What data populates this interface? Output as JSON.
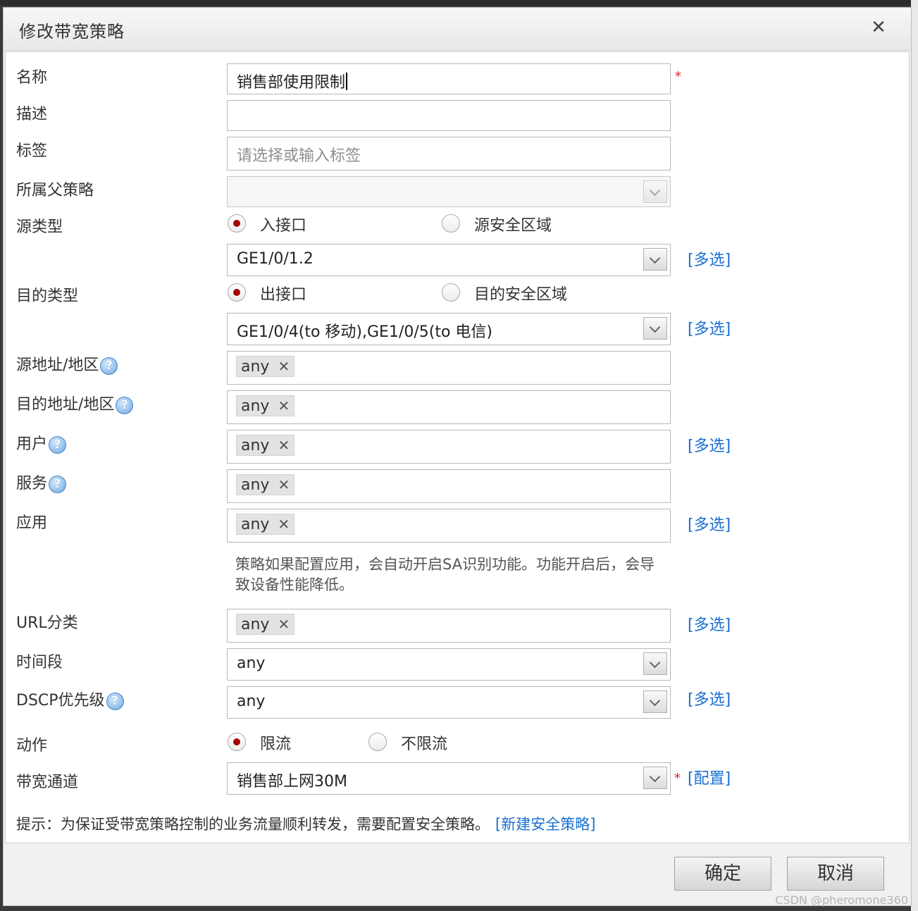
{
  "dialog": {
    "title": "修改带宽策略",
    "close_glyph": "✕"
  },
  "form": {
    "name": {
      "label": "名称",
      "value": "销售部使用限制",
      "required": "*"
    },
    "description": {
      "label": "描述",
      "value": ""
    },
    "tags": {
      "label": "标签",
      "placeholder": "请选择或输入标签"
    },
    "parent_policy": {
      "label": "所属父策略",
      "value": ""
    },
    "source_type": {
      "label": "源类型",
      "options": [
        "入接口",
        "源安全区域"
      ],
      "selected": "入接口"
    },
    "source_interface": {
      "value": "GE1/0/1.2",
      "link": "[多选]"
    },
    "dest_type": {
      "label": "目的类型",
      "options": [
        "出接口",
        "目的安全区域"
      ],
      "selected": "出接口"
    },
    "dest_interface": {
      "value": "GE1/0/4(to 移动),GE1/0/5(to 电信)",
      "link": "[多选]"
    },
    "source_address": {
      "label": "源地址/地区",
      "tag": "any"
    },
    "dest_address": {
      "label": "目的地址/地区",
      "tag": "any"
    },
    "user": {
      "label": "用户",
      "tag": "any",
      "link": "[多选]"
    },
    "service": {
      "label": "服务",
      "tag": "any"
    },
    "application": {
      "label": "应用",
      "tag": "any",
      "link": "[多选]",
      "note": "策略如果配置应用，会自动开启SA识别功能。功能开启后，会导致设备性能降低。"
    },
    "url_category": {
      "label": "URL分类",
      "tag": "any",
      "link": "[多选]"
    },
    "time_range": {
      "label": "时间段",
      "value": "any"
    },
    "dscp": {
      "label": "DSCP优先级",
      "value": "any",
      "link": "[多选]"
    },
    "action": {
      "label": "动作",
      "options": [
        "限流",
        "不限流"
      ],
      "selected": "限流"
    },
    "bandwidth_channel": {
      "label": "带宽通道",
      "value": "销售部上网30M",
      "required": "*",
      "link": "[配置]"
    },
    "tip": {
      "text": "提示：为保证受带宽策略控制的业务流量顺利转发，需要配置安全策略。",
      "link": "[新建安全策略]"
    }
  },
  "help_glyph": "?",
  "tag_remove_glyph": "✕",
  "buttons": {
    "ok": "确定",
    "cancel": "取消"
  },
  "watermark": "CSDN @pheromone360",
  "colors": {
    "link": "#1a6fd1",
    "required": "#e02020",
    "radio_selected": "#a40000"
  }
}
